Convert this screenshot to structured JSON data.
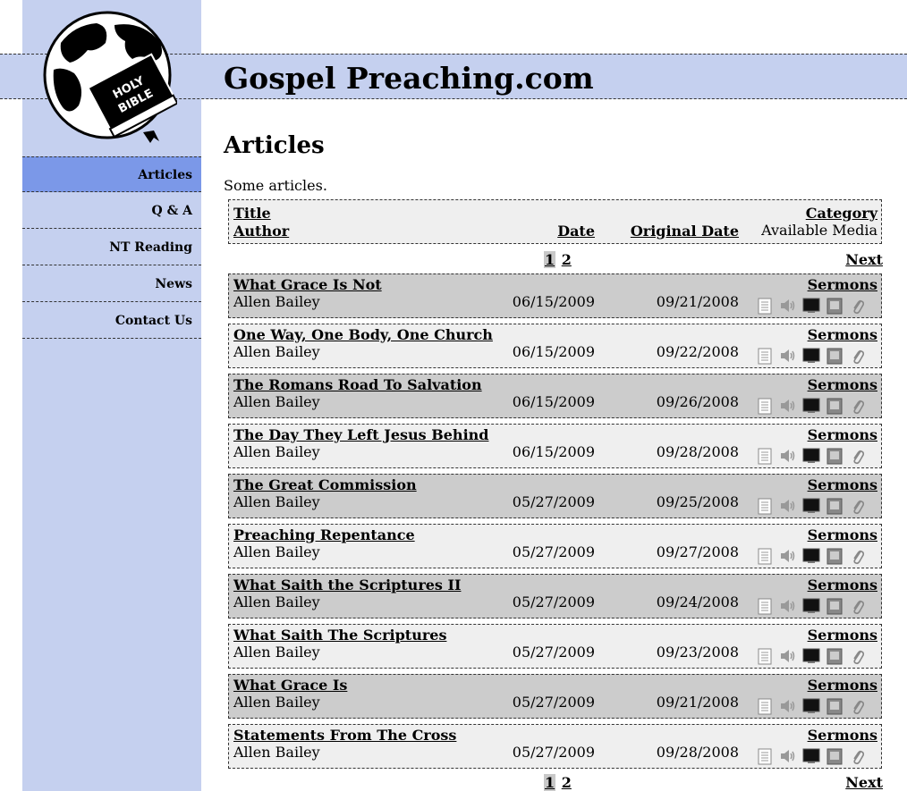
{
  "site": {
    "title": "Gospel Preaching.com",
    "logo_text": [
      "HOLY",
      "BIBLE"
    ]
  },
  "nav": [
    {
      "label": "Articles",
      "active": true
    },
    {
      "label": "Q & A",
      "active": false
    },
    {
      "label": "NT Reading",
      "active": false
    },
    {
      "label": "News",
      "active": false
    },
    {
      "label": "Contact Us",
      "active": false
    }
  ],
  "page": {
    "heading": "Articles",
    "intro": "Some articles."
  },
  "table_header": {
    "title": "Title",
    "author": "Author",
    "date": "Date",
    "original_date": "Original Date",
    "category": "Category",
    "available_media": "Available Media"
  },
  "pagination": {
    "pages": [
      "1",
      "2"
    ],
    "current": "1",
    "next": "Next"
  },
  "media_icons": [
    "document-icon",
    "audio-icon",
    "video-icon",
    "ebook-icon",
    "attachment-icon"
  ],
  "articles": [
    {
      "title": "What Grace Is Not",
      "author": "Allen Bailey",
      "date": "06/15/2009",
      "original_date": "09/21/2008",
      "category": "Sermons"
    },
    {
      "title": "One Way, One Body, One Church",
      "author": "Allen Bailey",
      "date": "06/15/2009",
      "original_date": "09/22/2008",
      "category": "Sermons"
    },
    {
      "title": "The Romans Road To Salvation",
      "author": "Allen Bailey",
      "date": "06/15/2009",
      "original_date": "09/26/2008",
      "category": "Sermons"
    },
    {
      "title": "The Day They Left Jesus Behind",
      "author": "Allen Bailey",
      "date": "06/15/2009",
      "original_date": "09/28/2008",
      "category": "Sermons"
    },
    {
      "title": "The Great Commission",
      "author": "Allen Bailey",
      "date": "05/27/2009",
      "original_date": "09/25/2008",
      "category": "Sermons"
    },
    {
      "title": "Preaching Repentance",
      "author": "Allen Bailey",
      "date": "05/27/2009",
      "original_date": "09/27/2008",
      "category": "Sermons"
    },
    {
      "title": "What Saith the Scriptures II",
      "author": "Allen Bailey",
      "date": "05/27/2009",
      "original_date": "09/24/2008",
      "category": "Sermons"
    },
    {
      "title": "What Saith The Scriptures",
      "author": "Allen Bailey",
      "date": "05/27/2009",
      "original_date": "09/23/2008",
      "category": "Sermons"
    },
    {
      "title": "What Grace Is",
      "author": "Allen Bailey",
      "date": "05/27/2009",
      "original_date": "09/21/2008",
      "category": "Sermons"
    },
    {
      "title": "Statements From The Cross",
      "author": "Allen Bailey",
      "date": "05/27/2009",
      "original_date": "09/28/2008",
      "category": "Sermons"
    }
  ],
  "colors": {
    "sidebar_bg": "#c5d0ef",
    "nav_active_bg": "#7b98e8",
    "row_dark": "#cccccc",
    "row_light": "#efefef"
  }
}
